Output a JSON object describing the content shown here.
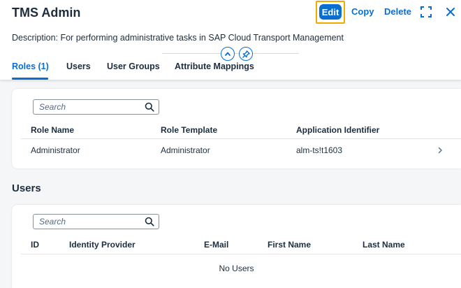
{
  "header": {
    "title": "TMS Admin",
    "actions": {
      "edit": "Edit",
      "copy": "Copy",
      "delete": "Delete"
    },
    "description_label": "Description:",
    "description_text": " For performing administrative tasks in SAP Cloud Transport Management"
  },
  "tabs": [
    {
      "label": "Roles (1)",
      "active": true
    },
    {
      "label": "Users",
      "active": false
    },
    {
      "label": "User Groups",
      "active": false
    },
    {
      "label": "Attribute Mappings",
      "active": false
    }
  ],
  "roles": {
    "search_placeholder": "Search",
    "columns": [
      "Role Name",
      "Role Template",
      "Application Identifier"
    ],
    "rows": [
      [
        "Administrator",
        "Administrator",
        "alm-ts!t1603"
      ]
    ]
  },
  "users": {
    "title": "Users",
    "search_placeholder": "Search",
    "columns": [
      "ID",
      "Identity Provider",
      "E-Mail",
      "First Name",
      "Last Name"
    ],
    "empty_text": "No Users"
  },
  "colors": {
    "accent": "#0a6ed1",
    "focus": "#f0ab00",
    "text": "#1d2d3e",
    "background": "#f5f6f7"
  },
  "icons": [
    "fullscreen-icon",
    "close-icon",
    "collapse-header-icon",
    "pin-icon",
    "search-icon",
    "chevron-right-icon"
  ]
}
